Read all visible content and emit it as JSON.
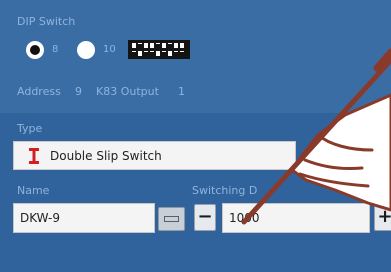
{
  "dip_switch": {
    "label": "DIP Switch",
    "options": [
      {
        "label": "8",
        "selected": true
      },
      {
        "label": "10",
        "selected": false
      }
    ],
    "address_label": "Address",
    "address_value": "9",
    "output_label": "K83 Output",
    "output_value": "1"
  },
  "type": {
    "label": "Type",
    "value": "Double Slip Switch",
    "icon": "double-slip-switch-icon",
    "icon_color": "#d21f1f"
  },
  "name": {
    "label": "Name",
    "value": "DKW-9"
  },
  "switching": {
    "label": "Switching D",
    "value": "1000",
    "decrement_label": "−",
    "increment_label": "+"
  },
  "colors": {
    "panel_top": "#3b6da5",
    "panel_bottom": "#30639c",
    "label_text": "#8fb3dd",
    "hand_stroke": "#8a3a2a"
  }
}
